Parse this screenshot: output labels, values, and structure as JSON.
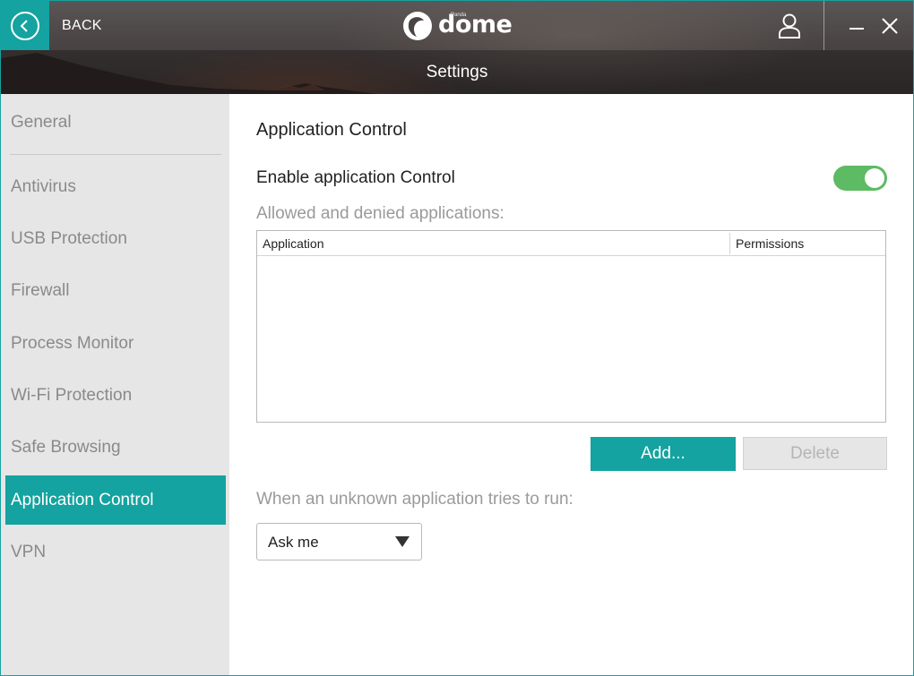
{
  "header": {
    "back_label": "BACK",
    "brand_name": "dome",
    "brand_small": "Panda",
    "page_title": "Settings",
    "icons": {
      "back": "chevron-left-circle-icon",
      "user": "user-icon",
      "minimize": "minimize-icon",
      "close": "close-icon"
    }
  },
  "sidebar": {
    "items": [
      {
        "label": "General",
        "active": false
      },
      {
        "label": "Antivirus",
        "active": false
      },
      {
        "label": "USB Protection",
        "active": false
      },
      {
        "label": "Firewall",
        "active": false
      },
      {
        "label": "Process Monitor",
        "active": false
      },
      {
        "label": "Wi-Fi Protection",
        "active": false
      },
      {
        "label": "Safe Browsing",
        "active": false
      },
      {
        "label": "Application Control",
        "active": true
      },
      {
        "label": "VPN",
        "active": false
      }
    ]
  },
  "main": {
    "title": "Application Control",
    "enable_label": "Enable application Control",
    "enabled": true,
    "list_caption": "Allowed and denied applications:",
    "table": {
      "columns": [
        "Application",
        "Permissions"
      ],
      "rows": []
    },
    "add_button": "Add...",
    "delete_button": "Delete",
    "unknown_label": "When an unknown application tries to run:",
    "unknown_action": {
      "selected": "Ask me"
    }
  },
  "colors": {
    "accent": "#14a3a0",
    "toggle_on": "#5dbb63",
    "sidebar_bg": "#e6e6e6",
    "muted_text": "#9a9a9a"
  }
}
